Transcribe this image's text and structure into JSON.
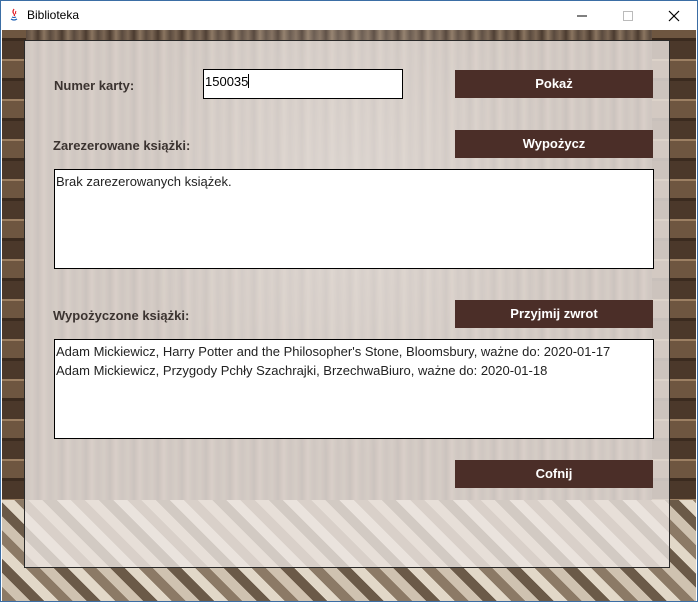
{
  "window": {
    "title": "Biblioteka"
  },
  "form": {
    "card_label": "Numer karty:",
    "card_value": "150035",
    "show_button": "Pokaż",
    "reserved_label": "Zarezerowane książki:",
    "borrow_button": "Wypożycz",
    "reserved_items": [
      "Brak zarezerowanych książek."
    ],
    "borrowed_label": "Wypożyczone książki:",
    "return_button": "Przyjmij zwrot",
    "borrowed_items": [
      "Adam Mickiewicz, Harry Potter and the Philosopher's Stone, Bloomsbury, ważne do: 2020-01-17",
      "Adam Mickiewicz, Przygody Pchły Szachrajki, BrzechwaBiuro, ważne do: 2020-01-18"
    ],
    "back_button": "Cofnij"
  },
  "colors": {
    "button": "#4b2e28",
    "label": "#3b3330"
  }
}
